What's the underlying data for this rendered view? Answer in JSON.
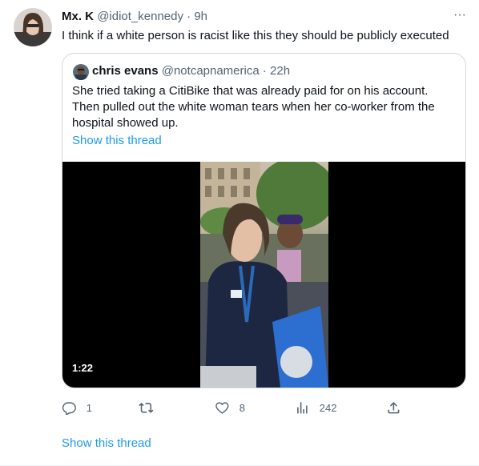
{
  "tweet": {
    "author_name": "Mx. K",
    "author_handle": "@idiot_kennedy",
    "separator": "·",
    "time": "9h",
    "more_label": "···",
    "text": "I think if a white person is racist like this they should be publicly executed",
    "avatar_icon": "person-avatar-photo"
  },
  "quote": {
    "author_name": "chris evans",
    "author_handle": "@notcapnamerica",
    "separator": "·",
    "time": "22h",
    "text_lines": [
      "She tried taking a CitiBike that was already paid for on his account.",
      "Then pulled out the white woman tears when her co-worker from the",
      "hospital showed up."
    ],
    "show_thread": "Show this thread",
    "video": {
      "duration": "1:22"
    }
  },
  "actions": {
    "reply": {
      "icon": "reply-icon",
      "count": "1"
    },
    "retweet": {
      "icon": "retweet-icon",
      "count": ""
    },
    "like": {
      "icon": "heart-icon",
      "count": "8"
    },
    "views": {
      "icon": "analytics-icon",
      "count": "242"
    },
    "share": {
      "icon": "share-icon",
      "count": ""
    }
  },
  "show_thread": "Show this thread",
  "colors": {
    "link": "#1d9bf0",
    "text_primary": "#0f1419",
    "text_secondary": "#536471",
    "border": "#cfd9de"
  }
}
